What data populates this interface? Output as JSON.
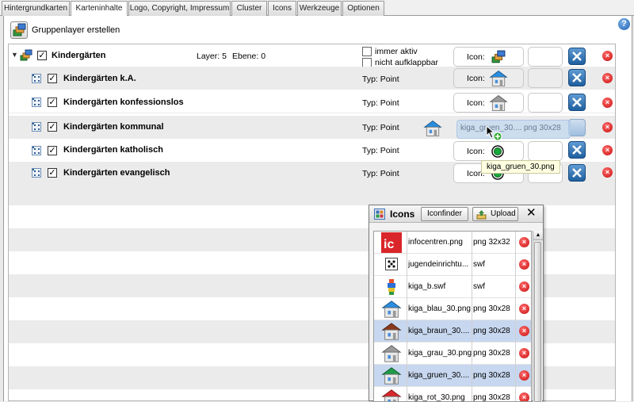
{
  "tabs": [
    {
      "label": "Hintergrundkarten"
    },
    {
      "label": "Karteninhalte"
    },
    {
      "label": "Logo, Copyright, Impressum"
    },
    {
      "label": "Cluster"
    },
    {
      "label": "Icons"
    },
    {
      "label": "Werkzeuge"
    },
    {
      "label": "Optionen"
    }
  ],
  "active_tab": "Karteninhalte",
  "help_label": "?",
  "create_group_label": "Gruppenlayer erstellen",
  "group": {
    "name": "Kindergärten",
    "layer_count": "Layer: 5",
    "level": "Ebene: 0",
    "always_active_label": "immer aktiv",
    "not_expandable_label": "nicht aufklappbar",
    "icon_label": "Icon:"
  },
  "layers": [
    {
      "name": "Kindergärten k.A.",
      "type": "Typ: Point",
      "icon_label": "Icon:",
      "icon": "house-blue-icon"
    },
    {
      "name": "Kindergärten konfessionslos",
      "type": "Typ: Point",
      "icon_label": "Icon:",
      "icon": "house-grey-icon"
    },
    {
      "name": "Kindergärten kommunal",
      "type": "Typ: Point",
      "icon_label": "Icon:",
      "icon": "house-blue-icon"
    },
    {
      "name": "Kindergärten katholisch",
      "type": "Typ: Point",
      "icon_label": "Icon:",
      "icon": "green-target-icon"
    },
    {
      "name": "Kindergärten evangelisch",
      "type": "Typ: Point",
      "icon_label": "Icon:",
      "icon": "green-target-icon"
    }
  ],
  "drag_ghost": {
    "name": "kiga_gruen_30....",
    "type": "png 30x28"
  },
  "tooltip": "kiga_gruen_30.png",
  "icons_dialog": {
    "title": "Icons",
    "iconfinder_label": "Iconfinder",
    "upload_label": "Upload",
    "close_label": "✕",
    "files": [
      {
        "name": "infocentren.png",
        "type": "png 32x32",
        "icon": "ic-logo-icon",
        "selected": false
      },
      {
        "name": "jugendeinrichtu...",
        "type": "swf",
        "icon": "dots-icon",
        "selected": false
      },
      {
        "name": "kiga_b.swf",
        "type": "swf",
        "icon": "kiga-figure-icon",
        "selected": false
      },
      {
        "name": "kiga_blau_30.png",
        "type": "png 30x28",
        "icon": "house-blue-icon",
        "selected": false
      },
      {
        "name": "kiga_braun_30....",
        "type": "png 30x28",
        "icon": "house-brown-icon",
        "selected": true
      },
      {
        "name": "kiga_grau_30.png",
        "type": "png 30x28",
        "icon": "house-grey-icon",
        "selected": false
      },
      {
        "name": "kiga_gruen_30....",
        "type": "png 30x28",
        "icon": "house-green-icon",
        "selected": true
      },
      {
        "name": "kiga_rot_30.png",
        "type": "png 30x28",
        "icon": "house-red-icon",
        "selected": false
      }
    ]
  },
  "colors": {
    "accent_blue": "#1e5f9f",
    "delete_red": "#c81010",
    "selection": "#c7d7ef",
    "tooltip_bg": "#ffffe1"
  }
}
